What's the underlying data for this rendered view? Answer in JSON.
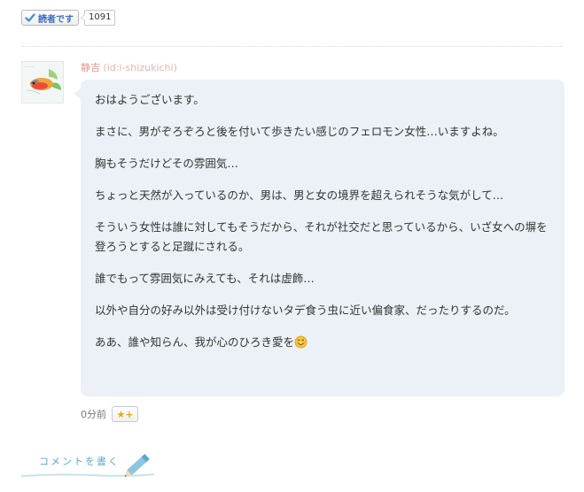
{
  "reader": {
    "label": "読者です",
    "count": "1091"
  },
  "comment": {
    "author_name": "静吉",
    "author_id": "(id:i-shizukichi)",
    "paragraphs": [
      "おはようございます。",
      "まさに、男がぞろぞろと後を付いて歩きたい感じのフェロモン女性…いますよね。",
      "胸もそうだけどその雰囲気…",
      "ちょっと天然が入っているのか、男は、男と女の境界を超えられそうな気がして…",
      "そういう女性は誰に対してもそうだから、それが社交だと思っているから、いざ女への塀を登ろうとすると足蹴にされる。",
      "誰でもって雰囲気にみえても、それは虚飾…",
      "以外や自分の好み以外は受け付けないタデ食う虫に近い偏食家、だったりするのだ。"
    ],
    "last_line": "ああ、誰や知らん、我が心のひろき愛を",
    "time": "0分前",
    "star_label": "★+"
  },
  "footer": {
    "write_comment_label": "コメントを書く"
  },
  "colors": {
    "bubble_bg": "#ebf1f6",
    "author": "#e8978a",
    "reader_text": "#3a6dbc",
    "write_comment": "#5da7c9"
  }
}
